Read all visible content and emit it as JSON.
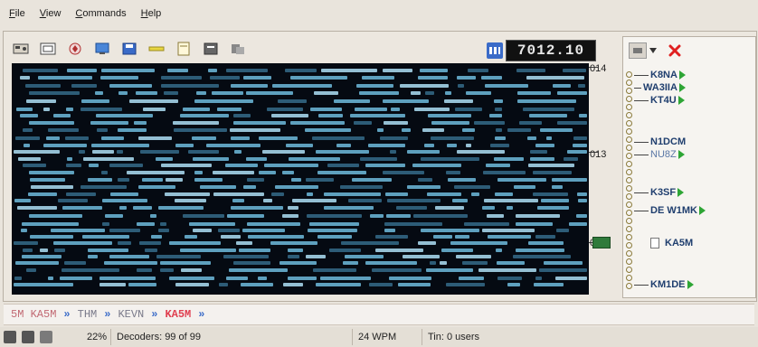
{
  "menu": [
    "File",
    "View",
    "Commands",
    "Help"
  ],
  "toolbar": {
    "buttons": [
      "rig-icon",
      "window-icon",
      "transmit-icon",
      "monitor-icon",
      "save-icon",
      "tune-icon",
      "note-icon",
      "contact-icon",
      "copy-icon"
    ]
  },
  "frequency": "7012.10",
  "ruler": {
    "labels": [
      "014",
      "013",
      "0"
    ]
  },
  "panel": {
    "calls": [
      {
        "call": "K8NA",
        "arrow": true,
        "style": "bold"
      },
      {
        "call": "WA3IIA",
        "arrow": true,
        "style": "bold"
      },
      {
        "call": "KT4U",
        "arrow": true,
        "style": "bold"
      },
      {
        "call": "N1DCM",
        "arrow": false,
        "style": "bold"
      },
      {
        "call": "NU8Z",
        "arrow": true,
        "style": "light"
      },
      {
        "call": "K3SF",
        "arrow": true,
        "style": "bold"
      },
      {
        "call": "DE W1MK",
        "arrow": true,
        "style": "bold"
      },
      {
        "call": "KA5M",
        "arrow": false,
        "style": "bold"
      },
      {
        "call": "KM1DE",
        "arrow": true,
        "style": "bold"
      }
    ]
  },
  "decoded": {
    "seg1": "5M KA5M",
    "sep": "»",
    "seg2": "THM",
    "seg3": "KEVN",
    "seg4": "KA5M"
  },
  "status": {
    "percent": "22%",
    "decoders": "Decoders: 99 of 99",
    "wpm": "24 WPM",
    "users": "Tin: 0 users"
  },
  "colors": {
    "waterfall_bg": "#050a12",
    "trace": "#6bb5d6",
    "arrow": "#2ea535",
    "close": "#e02020",
    "callsign": "#1f3e6e"
  }
}
